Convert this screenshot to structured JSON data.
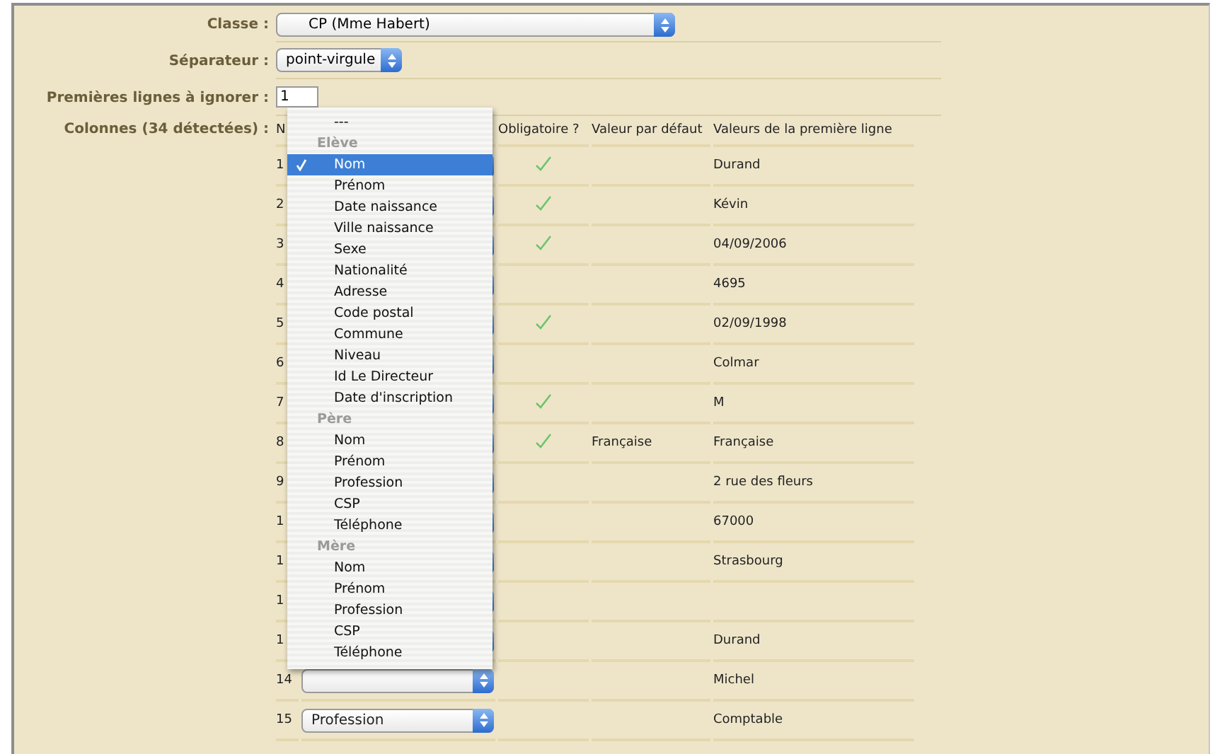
{
  "form": {
    "classe": {
      "label": "Classe :",
      "value": "CP (Mme Habert)"
    },
    "separateur": {
      "label": "Séparateur :",
      "value": "point-virgule"
    },
    "lignes": {
      "label": "Premières lignes à ignorer :",
      "value": "1"
    },
    "colonnes": {
      "label": "Colonnes (34 détectées) :"
    }
  },
  "table": {
    "number_header": "N",
    "columns": [
      "Obligatoire ?",
      "Valeur par défaut",
      "Valeurs de la première ligne"
    ],
    "rows": [
      {
        "number": "1",
        "required": true,
        "first_value": "Durand"
      },
      {
        "number": "2",
        "required": true,
        "first_value": "Kévin"
      },
      {
        "number": "3",
        "required": true,
        "first_value": "04/09/2006"
      },
      {
        "number": "4",
        "required": false,
        "first_value": "4695"
      },
      {
        "number": "5",
        "required": true,
        "first_value": "02/09/1998"
      },
      {
        "number": "6",
        "required": false,
        "first_value": "Colmar"
      },
      {
        "number": "7",
        "required": true,
        "first_value": "M"
      },
      {
        "number": "8",
        "required": true,
        "default": "Française",
        "first_value": "Française"
      },
      {
        "number": "9",
        "required": false,
        "first_value": "2 rue des fleurs"
      },
      {
        "number": "1",
        "required": false,
        "first_value": "67000"
      },
      {
        "number": "1",
        "required": false,
        "first_value": "Strasbourg"
      },
      {
        "number": "1",
        "required": false
      },
      {
        "number": "1",
        "required": false,
        "first_value": "Durand"
      },
      {
        "number": "14",
        "required": false,
        "first_value": "Michel"
      },
      {
        "number": "15",
        "field": "Profession",
        "required": false,
        "first_value": "Comptable"
      }
    ]
  },
  "menu": {
    "items": [
      {
        "kind": "option",
        "label": "---",
        "selected": false
      },
      {
        "kind": "group",
        "label": "Elève"
      },
      {
        "kind": "option",
        "label": "Nom",
        "selected": true
      },
      {
        "kind": "option",
        "label": "Prénom",
        "selected": false
      },
      {
        "kind": "option",
        "label": "Date naissance",
        "selected": false
      },
      {
        "kind": "option",
        "label": "Ville naissance",
        "selected": false
      },
      {
        "kind": "option",
        "label": "Sexe",
        "selected": false
      },
      {
        "kind": "option",
        "label": "Nationalité",
        "selected": false
      },
      {
        "kind": "option",
        "label": "Adresse",
        "selected": false
      },
      {
        "kind": "option",
        "label": "Code postal",
        "selected": false
      },
      {
        "kind": "option",
        "label": "Commune",
        "selected": false
      },
      {
        "kind": "option",
        "label": "Niveau",
        "selected": false
      },
      {
        "kind": "option",
        "label": "Id Le Directeur",
        "selected": false
      },
      {
        "kind": "option",
        "label": "Date d'inscription",
        "selected": false
      },
      {
        "kind": "group",
        "label": "Père"
      },
      {
        "kind": "option",
        "label": "Nom",
        "selected": false
      },
      {
        "kind": "option",
        "label": "Prénom",
        "selected": false
      },
      {
        "kind": "option",
        "label": "Profession",
        "selected": false
      },
      {
        "kind": "option",
        "label": "CSP",
        "selected": false
      },
      {
        "kind": "option",
        "label": "Téléphone",
        "selected": false
      },
      {
        "kind": "group",
        "label": "Mère"
      },
      {
        "kind": "option",
        "label": "Nom",
        "selected": false
      },
      {
        "kind": "option",
        "label": "Prénom",
        "selected": false
      },
      {
        "kind": "option",
        "label": "Profession",
        "selected": false
      },
      {
        "kind": "option",
        "label": "CSP",
        "selected": false
      },
      {
        "kind": "option",
        "label": "Téléphone",
        "selected": false
      }
    ]
  }
}
